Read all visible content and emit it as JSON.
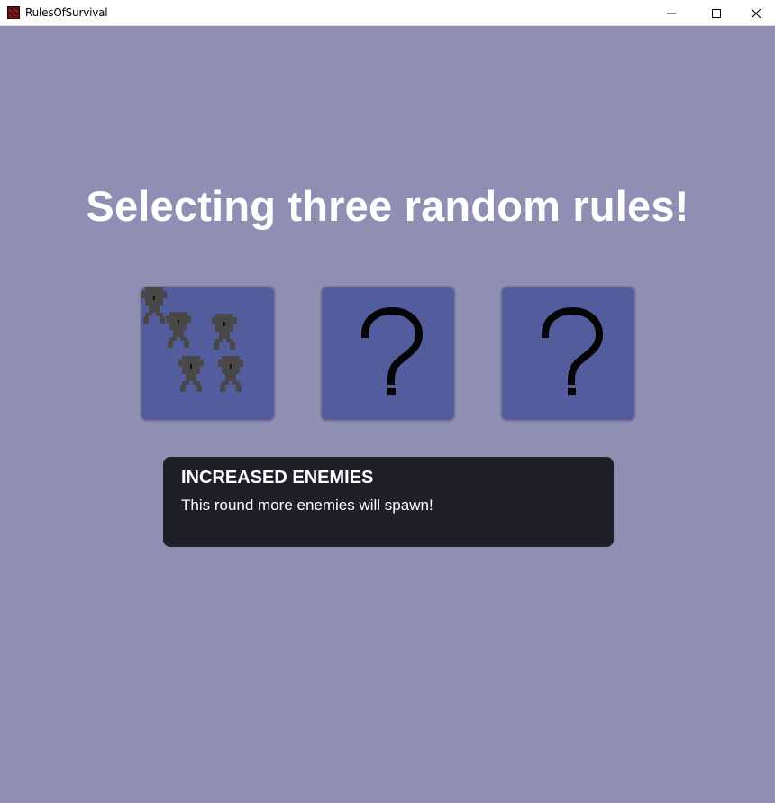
{
  "window": {
    "title": "RulesOfSurvival",
    "icon": "game-icon",
    "controls": [
      "minimize-icon",
      "maximize-icon",
      "close-icon"
    ]
  },
  "screen": {
    "heading": "Selecting three random rules!",
    "cards": [
      {
        "icon": "enemies-icon",
        "state": "revealed"
      },
      {
        "icon": "question-mark-icon",
        "state": "hidden"
      },
      {
        "icon": "question-mark-icon",
        "state": "hidden"
      }
    ],
    "rule": {
      "title": "INCREASED ENEMIES",
      "description": "This round more enemies will spawn!"
    }
  },
  "colors": {
    "background": "#8f8fb4",
    "card": "#535c9d",
    "panel": "#1f1f26",
    "text": "#ffffff"
  }
}
